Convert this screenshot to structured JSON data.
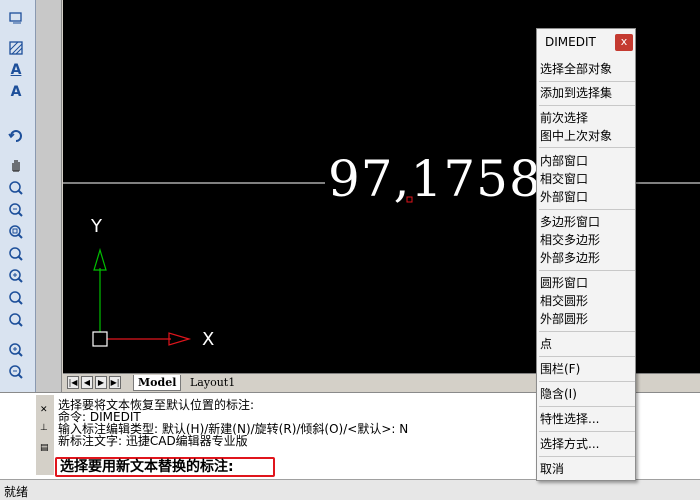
{
  "canvas": {
    "dimension_text": "97,1758",
    "y_axis_label": "Y",
    "x_axis_label": "X"
  },
  "tabs": {
    "model": "Model",
    "layout1": "Layout1"
  },
  "command": {
    "lines": [
      "选择要将文本恢复至默认位置的标注:",
      "命令:  DIMEDIT",
      "输入标注编辑类型: 默认(H)/新建(N)/旋转(R)/倾斜(O)/<默认>: N",
      "新标注文字: 迅捷CAD编辑器专业版"
    ],
    "prompt": "选择要用新文本替换的标注:"
  },
  "status": {
    "text": "就绪"
  },
  "menu": {
    "title": "DIMEDIT",
    "close": "x",
    "items": [
      "选择全部对象",
      "添加到选择集",
      "前次选择",
      "图中上次对象",
      "内部窗口",
      "相交窗口",
      "外部窗口",
      "多边形窗口",
      "相交多边形",
      "外部多边形",
      "圆形窗口",
      "相交圆形",
      "外部圆形",
      "点",
      "围栏(F)",
      "隐含(I)",
      "特性选择...",
      "选择方式...",
      "取消"
    ]
  },
  "colors": {
    "canvas_bg": "#000000",
    "axis_y": "#00c000",
    "axis_x": "#e0151c",
    "prompt_border": "#e0151c",
    "close_button": "#c43a30"
  }
}
